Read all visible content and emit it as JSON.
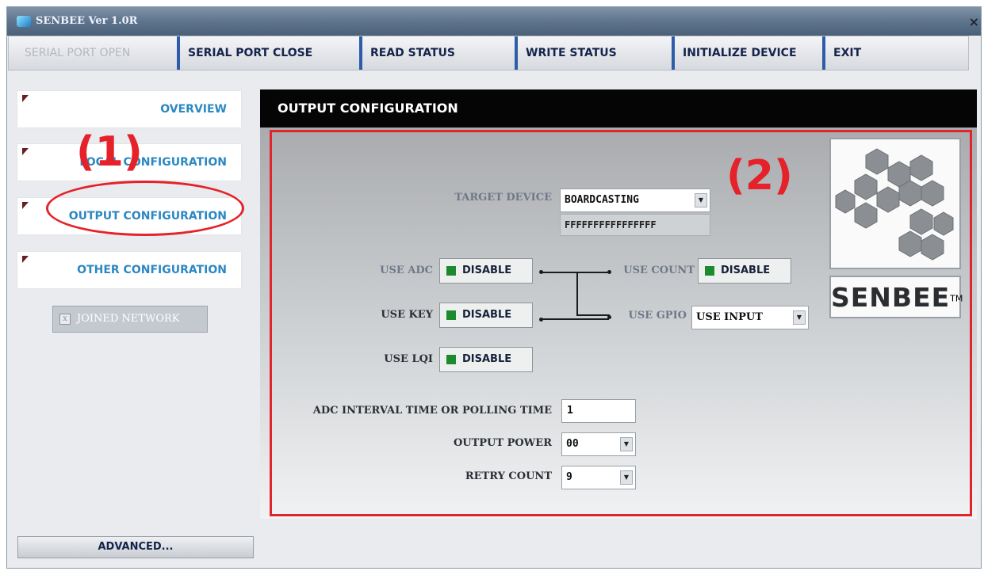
{
  "window": {
    "title": "SENBEE Ver 1.0R",
    "close_glyph": "×"
  },
  "toolbar": {
    "buttons": [
      {
        "label": "SERIAL PORT OPEN",
        "enabled": false
      },
      {
        "label": "SERIAL PORT CLOSE",
        "enabled": true
      },
      {
        "label": "READ STATUS",
        "enabled": true
      },
      {
        "label": "WRITE STATUS",
        "enabled": true
      },
      {
        "label": "INITIALIZE DEVICE",
        "enabled": true
      },
      {
        "label": "EXIT",
        "enabled": true
      }
    ]
  },
  "sidebar": {
    "items": [
      {
        "label": "OVERVIEW"
      },
      {
        "label": "LOCAL CONFIGURATION"
      },
      {
        "label": "OUTPUT CONFIGURATION"
      },
      {
        "label": "OTHER CONFIGURATION"
      }
    ],
    "joined_network": {
      "label": "JOINED NETWORK",
      "checked": false
    },
    "advanced_label": "ADVANCED..."
  },
  "annotations": {
    "one": "(1)",
    "two": "(2)",
    "color": "#e5222a"
  },
  "main": {
    "title": "OUTPUT CONFIGURATION",
    "target_device": {
      "label": "TARGET DEVICE",
      "value": "BOARDCASTING",
      "address": "FFFFFFFFFFFFFFFF"
    },
    "use_adc": {
      "label": "USE ADC",
      "value": "DISABLE"
    },
    "use_key": {
      "label": "USE KEY",
      "value": "DISABLE"
    },
    "use_lqi": {
      "label": "USE LQI",
      "value": "DISABLE"
    },
    "use_count": {
      "label": "USE COUNT",
      "value": "DISABLE"
    },
    "use_gpio": {
      "label": "USE GPIO",
      "value": "USE INPUT"
    },
    "adc_interval": {
      "label": "ADC INTERVAL TIME OR POLLING TIME",
      "value": "1"
    },
    "output_power": {
      "label": "OUTPUT POWER",
      "value": "00"
    },
    "retry_count": {
      "label": "RETRY COUNT",
      "value": "9"
    }
  },
  "logo": {
    "word": "SENBEE",
    "tm": "TM",
    "icon": "hexagon-cluster-icon"
  },
  "icons": {
    "dropdown": "▼",
    "checkbox": "x"
  },
  "colors": {
    "accent": "#2c88c2",
    "header_bg": "#050505",
    "highlight_red": "#e0262c",
    "status_green": "#1c8a2d"
  }
}
